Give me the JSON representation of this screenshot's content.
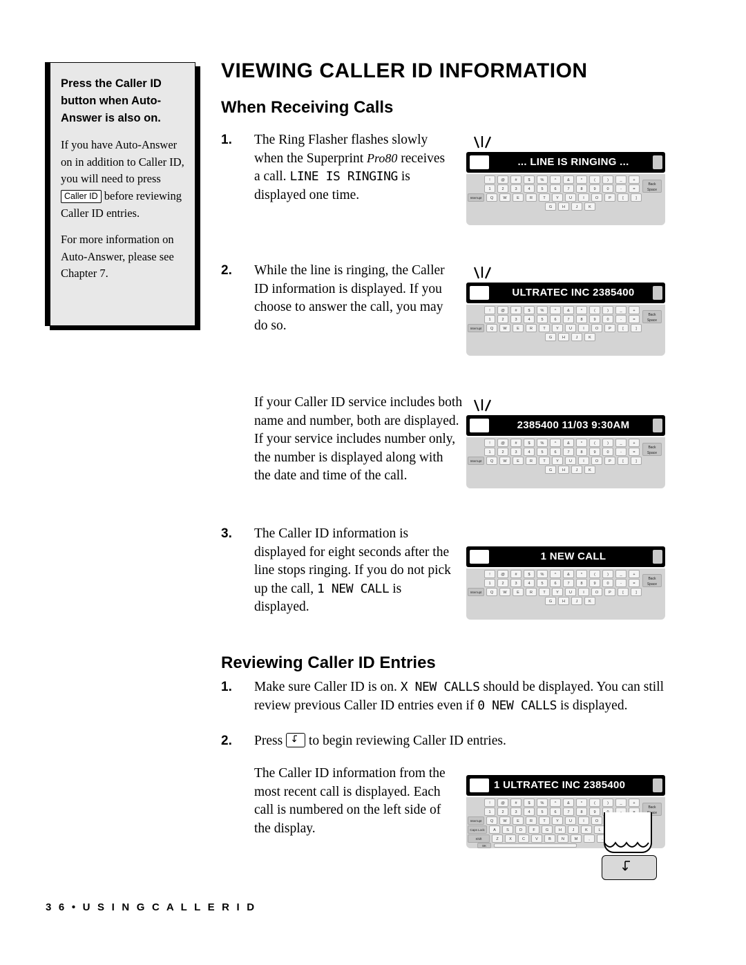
{
  "page": {
    "title": "VIEWING CALLER ID INFORMATION",
    "footer": "3 6  •  U S I N G  C A L L E R  I D"
  },
  "sidebar": {
    "lead": "Press the Caller ID button when Auto-Answer is also on.",
    "para1_a": "If you have Auto-Answer on in addition to Caller ID, you will need to press",
    "key_label": "Caller ID",
    "para1_b": "before reviewing Caller ID entries.",
    "para2": "For more information on Auto-Answer, please see Chapter 7."
  },
  "sections": {
    "receiving": "When Receiving Calls",
    "reviewing": "Reviewing Caller ID Entries"
  },
  "steps": {
    "s1": {
      "num": "1.",
      "t1": "The Ring Flasher flashes slowly when the Superprint ",
      "italic": "Pro80",
      "t2": " receives a call. ",
      "lcd1": "LINE IS RINGING",
      "t3": " is displayed one time."
    },
    "s2": {
      "num": "2.",
      "text": "While the line is ringing, the Caller ID information is displayed. If you choose to answer the call, you may do so."
    },
    "s2b": {
      "text": "If your Caller ID service includes both name and number, both are displayed. If your service includes number only, the number is displayed along with the date and time of the call."
    },
    "s3": {
      "num": "3.",
      "t1": "The Caller ID information is displayed for eight seconds after the line stops ringing. If you do not pick up the call, ",
      "lcd1": "1 NEW CALL",
      "t2": " is displayed."
    },
    "r1": {
      "num": "1.",
      "t1": "Make sure Caller ID is on. ",
      "lcd1": "X NEW CALLS",
      "t2": " should be displayed. You can still review previous Caller ID entries even if ",
      "lcd2": "0 NEW CALLS",
      "t3": " is displayed."
    },
    "r2": {
      "num": "2.",
      "t1": "Press",
      "t2": "to begin reviewing Caller ID entries."
    },
    "r2b": {
      "text": "The Caller ID information from the most recent call is displayed. Each call is numbered on the left side of the display."
    }
  },
  "devices": [
    {
      "name": "device-line-is-ringing",
      "display": "...  LINE IS RINGING ...",
      "align": "center",
      "flasher": true
    },
    {
      "name": "device-ultratec-inc",
      "display": "ULTRATEC INC 2385400",
      "align": "center",
      "flasher": true
    },
    {
      "name": "device-number-date-time",
      "display": "2385400 11/03  9:30AM",
      "align": "center",
      "flasher": true
    },
    {
      "name": "device-one-new-call",
      "display": "1 NEW CALL",
      "align": "center",
      "flasher": false
    },
    {
      "name": "device-review-entry",
      "display": "1 ULTRATEC INC  2385400",
      "align": "left",
      "flasher": false
    }
  ],
  "keyboard": {
    "row_symbols": [
      "!",
      "@",
      "#",
      "$",
      "%",
      "^",
      "&",
      "*",
      "(",
      ")",
      "_",
      "+"
    ],
    "row_numbers": [
      "1",
      "2",
      "3",
      "4",
      "5",
      "6",
      "7",
      "8",
      "9",
      "0",
      "-",
      "="
    ],
    "row_q": [
      "Q",
      "W",
      "E",
      "R",
      "T",
      "Y",
      "U",
      "I",
      "O",
      "P",
      "[",
      "]"
    ],
    "row_a": [
      "A",
      "S",
      "D",
      "F",
      "G",
      "H",
      "J",
      "K",
      "L",
      ";",
      "'"
    ],
    "row_z": [
      "Z",
      "X",
      "C",
      "V",
      "B",
      "N",
      "M",
      ",",
      ".",
      "/"
    ],
    "tab_label": "Interrupt",
    "caps_label": "Caps Lock",
    "shift_label": "Shift",
    "back_label": "Back Space",
    "space_label": "SK"
  }
}
